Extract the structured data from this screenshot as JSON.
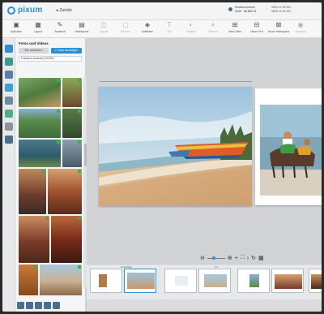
{
  "app": {
    "logo_text": "pixum"
  },
  "header": {
    "back_label": "Zurück",
    "user_line1": "Kundennummer",
    "user_line2": "0049 · 88 863 21",
    "meta_line1": "0800 10 98 301",
    "meta_line2": "0800 10 98 301"
  },
  "toolbar": {
    "items": [
      {
        "label": "Speichern",
        "icon": "save-icon",
        "glyph": "▣",
        "enabled": true
      },
      {
        "label": "Layout",
        "icon": "layout-icon",
        "glyph": "▦",
        "enabled": true
      },
      {
        "label": "Assistent",
        "icon": "wand-icon",
        "glyph": "✎",
        "enabled": true
      },
      {
        "label": "Hintergrund",
        "icon": "background-icon",
        "glyph": "▤",
        "enabled": true
      },
      {
        "label": "Cliparts",
        "icon": "clipart-icon",
        "glyph": "◫",
        "enabled": false
      },
      {
        "label": "Rahmen",
        "icon": "frame-icon",
        "glyph": "▢",
        "enabled": false
      },
      {
        "label": "Aufkleben",
        "icon": "sticker-icon",
        "glyph": "◈",
        "enabled": true
      },
      {
        "label": "Text",
        "icon": "text-icon",
        "glyph": "T",
        "enabled": false
      },
      {
        "label": "Masken",
        "icon": "mask-icon",
        "glyph": "◐",
        "enabled": false
      },
      {
        "label": "Ebenen",
        "icon": "layers-icon",
        "glyph": "≡",
        "enabled": false
      },
      {
        "label": "Neue Seite",
        "icon": "new-page-icon",
        "glyph": "⊞",
        "enabled": true
      },
      {
        "label": "Neuer Text",
        "icon": "new-text-icon",
        "glyph": "⊟",
        "enabled": true
      },
      {
        "label": "Neuer Hintergrund",
        "icon": "new-background-icon",
        "glyph": "⊠",
        "enabled": true
      },
      {
        "label": "Vorschau",
        "icon": "preview-icon",
        "glyph": "◉",
        "enabled": false
      }
    ]
  },
  "panel": {
    "title": "Fotos und Videos",
    "button_add": "+ Fotos hinzufügen",
    "button_more": "Alle auswählen",
    "search_value": "Fotobuch-Auswahl (24/200)"
  },
  "zoom": {
    "minus": "−",
    "plus": "+",
    "fit": "⛶"
  },
  "filmstrip": {
    "label_cover": "Umschlag",
    "label_page": "1 2"
  },
  "status": {
    "left": "",
    "right": ""
  },
  "colors": {
    "accent": "#2e8fd3",
    "check": "#37b34a"
  }
}
